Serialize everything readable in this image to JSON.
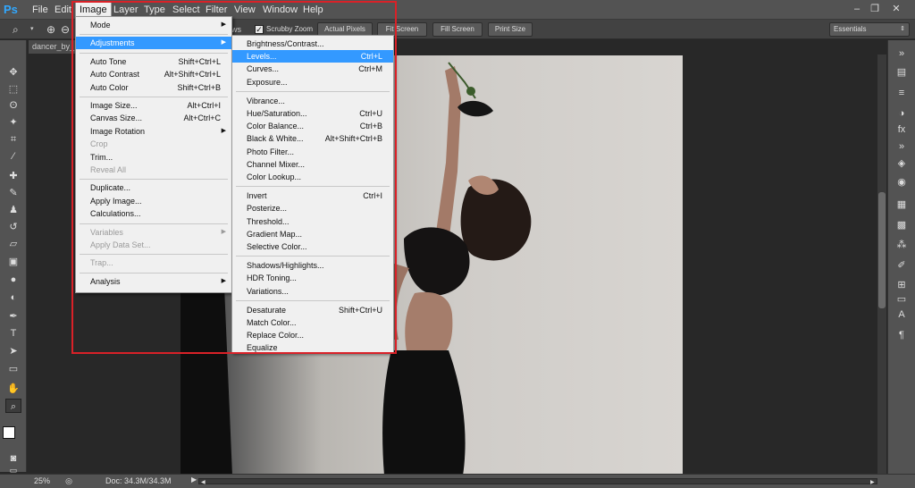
{
  "app": {
    "logo": "Ps"
  },
  "menubar": {
    "items": [
      "File",
      "Edit",
      "Image",
      "Layer",
      "Type",
      "Select",
      "Filter",
      "View",
      "Window",
      "Help"
    ],
    "active": "Image",
    "window_controls": [
      "–",
      "❐",
      "✕"
    ]
  },
  "options": {
    "partial_label": "ws",
    "scrubby_zoom": "Scrubby Zoom",
    "scrubby_checked": true,
    "buttons": [
      "Actual Pixels",
      "Fit Screen",
      "Fill Screen",
      "Print Size"
    ],
    "workspace": "Essentials"
  },
  "document": {
    "tab_title": "dancer_by_"
  },
  "status": {
    "zoom": "25%",
    "doc": "Doc: 34.3M/34.3M"
  },
  "image_menu": {
    "items": [
      {
        "label": "Mode",
        "shortcut": "",
        "submenu": true,
        "disabled": false
      },
      {
        "sep": true
      },
      {
        "label": "Adjustments",
        "shortcut": "",
        "submenu": true,
        "disabled": false,
        "highlight": true
      },
      {
        "sep": true
      },
      {
        "label": "Auto Tone",
        "shortcut": "Shift+Ctrl+L"
      },
      {
        "label": "Auto Contrast",
        "shortcut": "Alt+Shift+Ctrl+L"
      },
      {
        "label": "Auto Color",
        "shortcut": "Shift+Ctrl+B"
      },
      {
        "sep": true
      },
      {
        "label": "Image Size...",
        "shortcut": "Alt+Ctrl+I"
      },
      {
        "label": "Canvas Size...",
        "shortcut": "Alt+Ctrl+C"
      },
      {
        "label": "Image Rotation",
        "shortcut": "",
        "submenu": true
      },
      {
        "label": "Crop",
        "shortcut": "",
        "disabled": true
      },
      {
        "label": "Trim...",
        "shortcut": ""
      },
      {
        "label": "Reveal All",
        "shortcut": "",
        "disabled": true
      },
      {
        "sep": true
      },
      {
        "label": "Duplicate...",
        "shortcut": ""
      },
      {
        "label": "Apply Image...",
        "shortcut": ""
      },
      {
        "label": "Calculations...",
        "shortcut": ""
      },
      {
        "sep": true
      },
      {
        "label": "Variables",
        "shortcut": "",
        "submenu": true,
        "disabled": true
      },
      {
        "label": "Apply Data Set...",
        "shortcut": "",
        "disabled": true
      },
      {
        "sep": true
      },
      {
        "label": "Trap...",
        "shortcut": "",
        "disabled": true
      },
      {
        "sep": true
      },
      {
        "label": "Analysis",
        "shortcut": "",
        "submenu": true
      }
    ]
  },
  "adjustments_menu": {
    "items": [
      {
        "label": "Brightness/Contrast...",
        "shortcut": ""
      },
      {
        "label": "Levels...",
        "shortcut": "Ctrl+L",
        "highlight": true
      },
      {
        "label": "Curves...",
        "shortcut": "Ctrl+M"
      },
      {
        "label": "Exposure...",
        "shortcut": ""
      },
      {
        "sep": true
      },
      {
        "label": "Vibrance...",
        "shortcut": ""
      },
      {
        "label": "Hue/Saturation...",
        "shortcut": "Ctrl+U"
      },
      {
        "label": "Color Balance...",
        "shortcut": "Ctrl+B"
      },
      {
        "label": "Black & White...",
        "shortcut": "Alt+Shift+Ctrl+B"
      },
      {
        "label": "Photo Filter...",
        "shortcut": ""
      },
      {
        "label": "Channel Mixer...",
        "shortcut": ""
      },
      {
        "label": "Color Lookup...",
        "shortcut": ""
      },
      {
        "sep": true
      },
      {
        "label": "Invert",
        "shortcut": "Ctrl+I"
      },
      {
        "label": "Posterize...",
        "shortcut": ""
      },
      {
        "label": "Threshold...",
        "shortcut": ""
      },
      {
        "label": "Gradient Map...",
        "shortcut": ""
      },
      {
        "label": "Selective Color...",
        "shortcut": ""
      },
      {
        "sep": true
      },
      {
        "label": "Shadows/Highlights...",
        "shortcut": ""
      },
      {
        "label": "HDR Toning...",
        "shortcut": ""
      },
      {
        "label": "Variations...",
        "shortcut": ""
      },
      {
        "sep": true
      },
      {
        "label": "Desaturate",
        "shortcut": "Shift+Ctrl+U"
      },
      {
        "label": "Match Color...",
        "shortcut": ""
      },
      {
        "label": "Replace Color...",
        "shortcut": ""
      },
      {
        "label": "Equalize",
        "shortcut": ""
      }
    ]
  },
  "colors": {
    "highlight": "#3399ff",
    "callout": "#d92128",
    "menu_bg": "#f0f0f0"
  }
}
